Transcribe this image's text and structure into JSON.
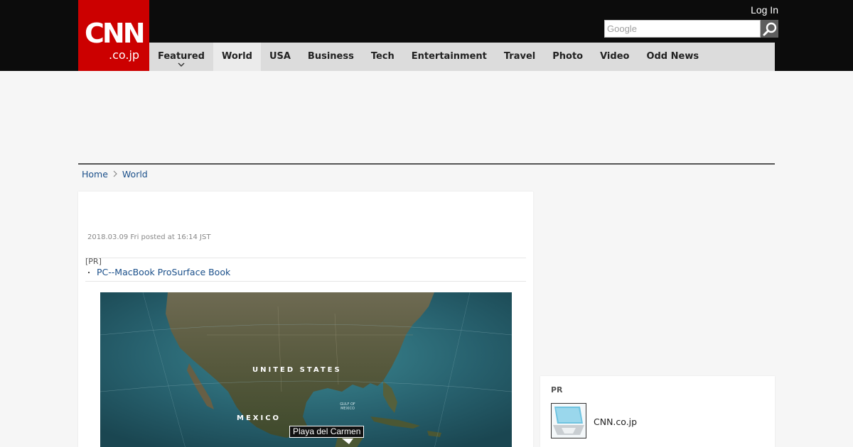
{
  "header": {
    "logo_main": "CNN",
    "logo_sub": ".co.jp",
    "login_label": "Log In",
    "search_placeholder": "Google",
    "brand_color": "#cc0000"
  },
  "nav": {
    "items": [
      {
        "label": "Featured"
      },
      {
        "label": "World"
      },
      {
        "label": "USA"
      },
      {
        "label": "Business"
      },
      {
        "label": "Tech"
      },
      {
        "label": "Entertainment"
      },
      {
        "label": "Travel"
      },
      {
        "label": "Photo"
      },
      {
        "label": "Video"
      },
      {
        "label": "Odd News"
      }
    ],
    "active": "World"
  },
  "breadcrumb": {
    "home": "Home",
    "current": "World"
  },
  "article": {
    "date": "2018.03.09 Fri posted at 16:14 JST",
    "pr_label": "[PR]",
    "pr_link": "PC--MacBook ProSurface Book",
    "map": {
      "label_us": "UNITED STATES",
      "label_mexico": "MEXICO",
      "label_gulf": "GULF OF MEXICO",
      "pin_label": "Playa del Carmen"
    }
  },
  "sidebar": {
    "pr_title": "PR",
    "pr_item_text": "CNN.co.jp"
  },
  "icons": {
    "search": "search-icon",
    "chevron": "chevron-down-icon",
    "breadcrumb_sep": "chevron-right-icon"
  }
}
